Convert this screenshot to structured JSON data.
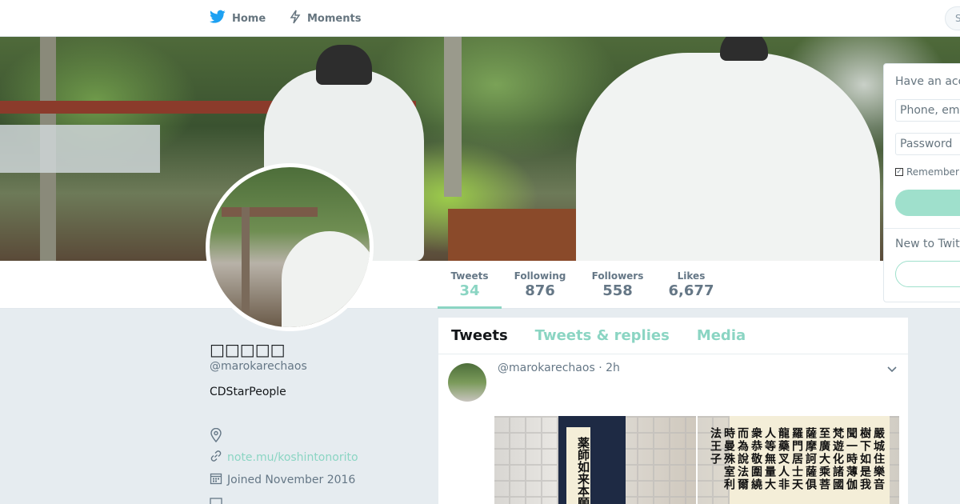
{
  "nav": {
    "home_label": "Home",
    "moments_label": "Moments",
    "search_placeholder": "S"
  },
  "profile": {
    "name": "□□□□□",
    "handle": "@marokarechaos",
    "bio": "CDStarPeople",
    "url": "note.mu/koshintonorito",
    "joined": "Joined November 2016"
  },
  "stats": {
    "tweets_label": "Tweets",
    "tweets_value": "34",
    "following_label": "Following",
    "following_value": "876",
    "followers_label": "Followers",
    "followers_value": "558",
    "likes_label": "Likes",
    "likes_value": "6,677"
  },
  "timeline": {
    "tabs": [
      "Tweets",
      "Tweets & replies",
      "Media"
    ],
    "tweet": {
      "handle": "@marokarechaos",
      "time": "2h",
      "image1_text": "薬師如来本願",
      "image2_text": "嚴城住樂音樹下如是我聞一時薄伽梵遊化諸國至廣大乘菩薩摩訶薩俱羅門居士天龍藥叉人非人等無量大衆恭敬圍繞而為說法爾時曼殊室利法王子"
    }
  },
  "login": {
    "title": "Have an account?",
    "phone_placeholder": "Phone, email or username",
    "password_placeholder": "Password",
    "remember_label": "Remember me",
    "new_label": "New to Twitter?"
  },
  "colors": {
    "accent": "#8bd5c3",
    "background": "#e6ecf0",
    "twitter_blue": "#1da1f2"
  }
}
